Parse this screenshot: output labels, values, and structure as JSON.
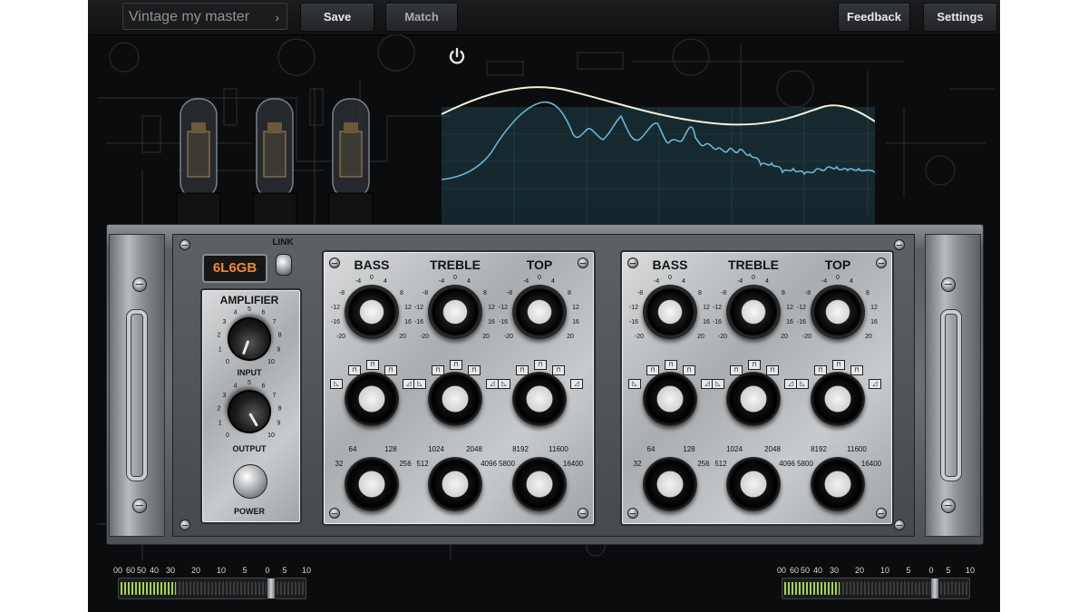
{
  "topbar": {
    "preset_name": "Vintage my master",
    "save_label": "Save",
    "match_label": "Match",
    "feedback_label": "Feedback",
    "settings_label": "Settings"
  },
  "tube_type": "6L6GB",
  "link_label": "LINK",
  "amplifier": {
    "title": "AMPLIFIER",
    "input_label": "INPUT",
    "output_label": "OUTPUT",
    "power_label": "POWER",
    "dial_scale": [
      "0",
      "1",
      "2",
      "3",
      "4",
      "5",
      "6",
      "7",
      "8",
      "9",
      "10"
    ]
  },
  "eq_left": {
    "bands": [
      {
        "title": "BASS",
        "low_freqs": [
          "64",
          "128"
        ],
        "side_freqs": [
          "32",
          "256"
        ]
      },
      {
        "title": "TREBLE",
        "low_freqs": [
          "1024",
          "2048"
        ],
        "side_freqs": [
          "512",
          "4096"
        ]
      },
      {
        "title": "TOP",
        "low_freqs": [
          "8192",
          "11600"
        ],
        "side_freqs": [
          "5800",
          "16400"
        ]
      }
    ]
  },
  "eq_right": {
    "bands": [
      {
        "title": "BASS",
        "low_freqs": [
          "64",
          "128"
        ],
        "side_freqs": [
          "32",
          "256"
        ]
      },
      {
        "title": "TREBLE",
        "low_freqs": [
          "1024",
          "2048"
        ],
        "side_freqs": [
          "512",
          "4096"
        ]
      },
      {
        "title": "TOP",
        "low_freqs": [
          "8192",
          "11600"
        ],
        "side_freqs": [
          "5800",
          "16400"
        ]
      }
    ]
  },
  "gain_scale": {
    "top": [
      "-4",
      "0",
      "4"
    ],
    "upper": [
      "-8",
      "8"
    ],
    "mid_upper": [
      "-12",
      "12"
    ],
    "mid_lower": [
      "-16",
      "16"
    ],
    "bottom": [
      "-20",
      "20"
    ]
  },
  "meters": {
    "scale": [
      "00",
      "60",
      "50",
      "40",
      "30",
      "20",
      "10",
      "5",
      "0",
      "5",
      "10"
    ],
    "left_level": 0.3,
    "right_level": 0.3
  },
  "colors": {
    "accent_orange": "#f08a2a",
    "spectrum_line": "#6ab4d8",
    "target_curve": "#f2f0d8",
    "meter_green": "#a8d640"
  },
  "icons": {
    "power": "power-icon",
    "preset_chevron": "chevron-right-icon"
  }
}
